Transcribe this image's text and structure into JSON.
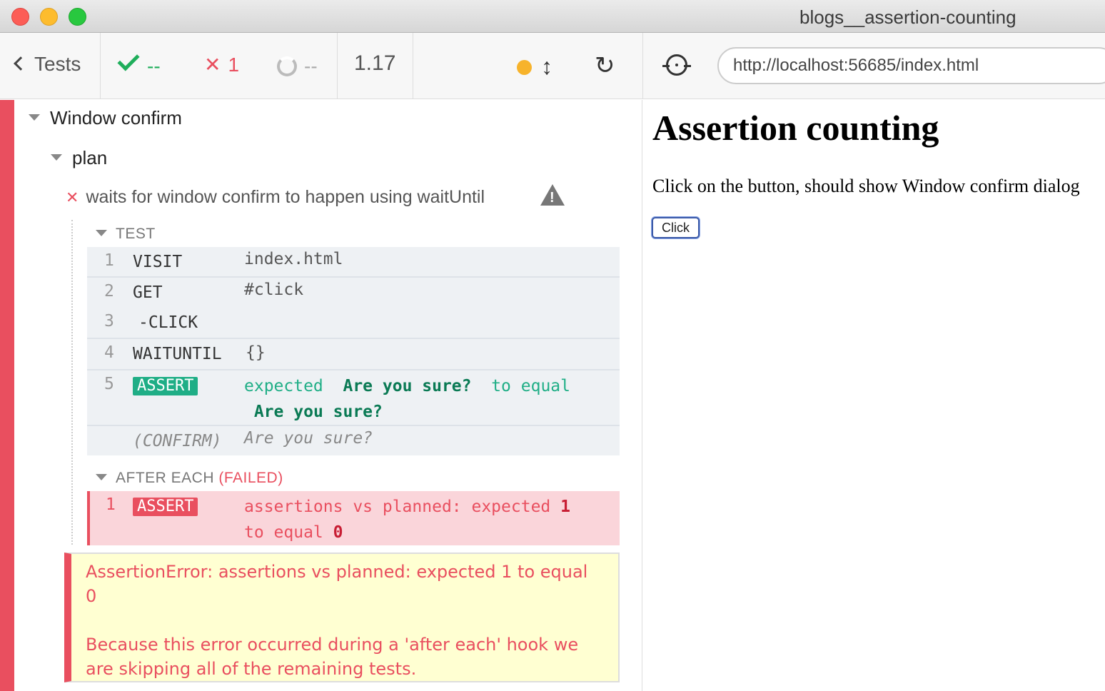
{
  "window": {
    "title": "blogs__assertion-counting"
  },
  "toolbar": {
    "back_label": "Tests",
    "passed": "--",
    "failed": "1",
    "pending": "--",
    "duration": "1.17"
  },
  "aut_toolbar": {
    "url": "http://localhost:56685/index.html"
  },
  "reporter": {
    "suite": "Window confirm",
    "subsuite": "plan",
    "test": "waits for window confirm to happen using waitUntil",
    "test_hook_label": "TEST",
    "commands": [
      {
        "num": "1",
        "name": "VISIT",
        "message": "index.html"
      },
      {
        "num": "2",
        "name": "GET",
        "message": "#click"
      },
      {
        "num": "3",
        "name": "-CLICK",
        "message": ""
      },
      {
        "num": "4",
        "name": "WAITUNTIL",
        "message": "{}"
      },
      {
        "num": "5",
        "name": "ASSERT",
        "msg_expected": "expected",
        "msg_value1": "Are you sure?",
        "msg_to_equal": "to equal",
        "msg_value2": "Are you sure?"
      },
      {
        "num": "",
        "name": "(CONFIRM)",
        "message": "Are you sure?"
      }
    ],
    "after_each_label": "AFTER EACH",
    "after_each_failed": "(FAILED)",
    "after_command": {
      "num": "1",
      "name": "ASSERT",
      "msg_part1": "assertions vs planned: expected",
      "value1": "1",
      "msg_part2": "to equal",
      "value2": "0"
    },
    "error": {
      "line1": "AssertionError: assertions vs planned: expected 1 to equal 0",
      "line2": "Because this error occurred during a 'after each' hook we are skipping all of the remaining tests."
    }
  },
  "aut": {
    "heading": "Assertion counting",
    "text": "Click on the button, should show Window confirm dialog",
    "button_label": "Click"
  },
  "colors": {
    "fail": "#e94f5f",
    "pass": "#1fae86",
    "running": "#f7b32b"
  }
}
